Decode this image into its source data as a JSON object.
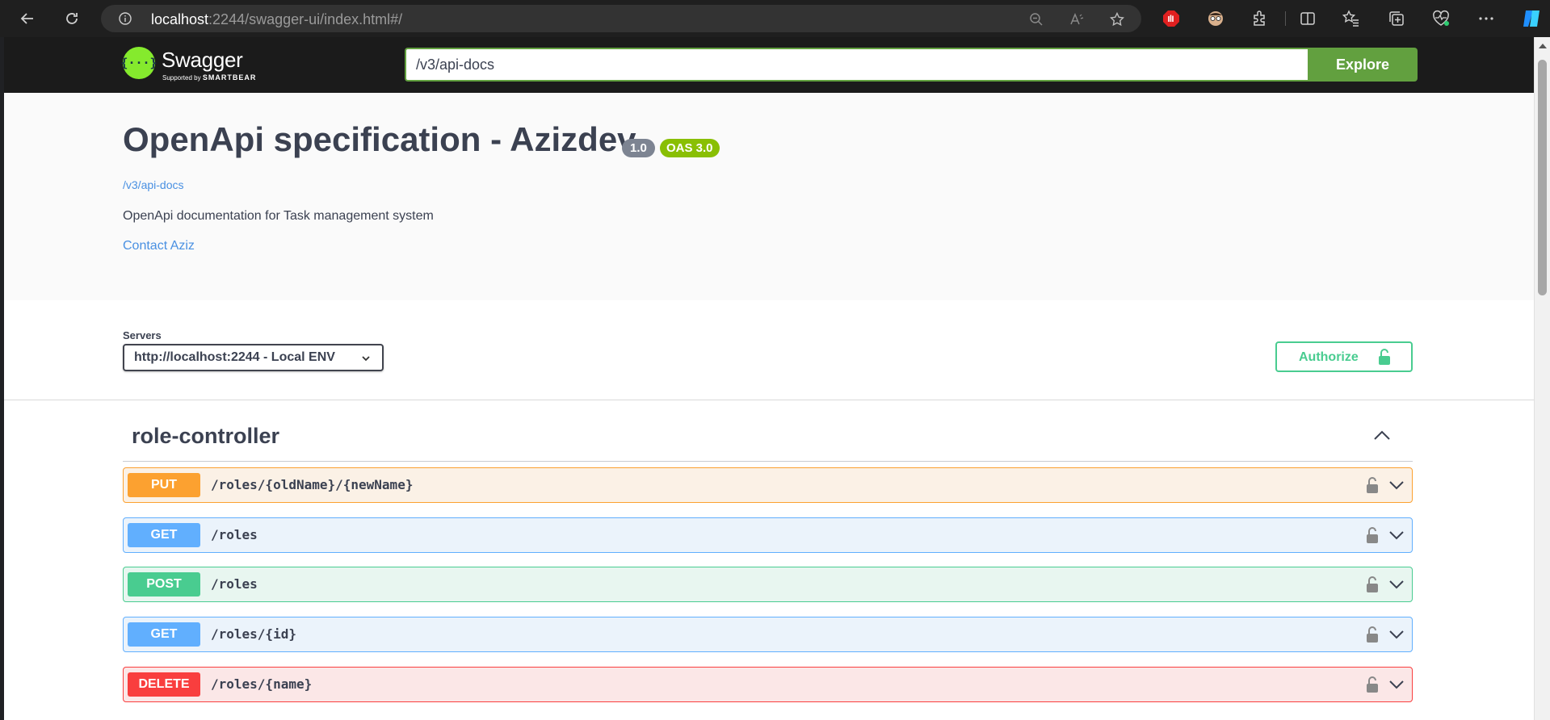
{
  "browser": {
    "url_host": "localhost",
    "url_rest": ":2244/swagger-ui/index.html#/"
  },
  "swagger": {
    "logo_text": "Swagger",
    "logo_sub_prefix": "Supported by",
    "logo_sub_brand": "SMARTBEAR",
    "spec_url": "/v3/api-docs",
    "explore_label": "Explore"
  },
  "info": {
    "title": "OpenApi specification - Azizdev",
    "version": "1.0",
    "oas": "OAS 3.0",
    "url": "/v3/api-docs",
    "description": "OpenApi documentation for Task management system",
    "contact": "Contact Aziz"
  },
  "servers": {
    "label": "Servers",
    "selected": "http://localhost:2244 - Local ENV"
  },
  "authorize_label": "Authorize",
  "tag": {
    "name": "role-controller",
    "expanded": true
  },
  "operations": [
    {
      "method": "PUT",
      "path": "/roles/{oldName}/{newName}"
    },
    {
      "method": "GET",
      "path": "/roles"
    },
    {
      "method": "POST",
      "path": "/roles"
    },
    {
      "method": "GET",
      "path": "/roles/{id}"
    },
    {
      "method": "DELETE",
      "path": "/roles/{name}"
    }
  ],
  "colors": {
    "put": "#fca130",
    "get": "#61affe",
    "post": "#49cc90",
    "delete": "#f93e3e",
    "swagger_green": "#85ea2d",
    "explore_green": "#62a03f",
    "link": "#4990e2"
  }
}
